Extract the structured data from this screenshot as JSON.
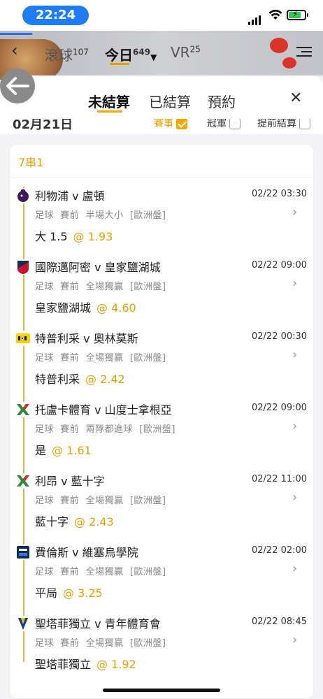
{
  "status": {
    "time": "22:24"
  },
  "app_header": {
    "tabs": [
      {
        "label": "滾球",
        "count": "107"
      },
      {
        "label": "今日",
        "count": "649"
      },
      {
        "label": "VR",
        "count": "25"
      }
    ]
  },
  "sheet": {
    "tabs": [
      "未結算",
      "已結算",
      "預約"
    ],
    "date": "02月21日",
    "filters": [
      {
        "label": "賽事",
        "checked": true
      },
      {
        "label": "冠軍",
        "checked": false
      },
      {
        "label": "提前結算",
        "checked": false
      }
    ],
    "parlay_title": "7串1",
    "legs": [
      {
        "match": "利物浦 v 盧頓",
        "datetime": "02/22 03:30",
        "sport": "足球",
        "stage": "賽前",
        "market": "半場大小",
        "line": "[歐洲盤]",
        "pick": "大 1.5",
        "odds": "@ 1.93",
        "logo_icon": "premier-league-icon"
      },
      {
        "match": "國際邁阿密 v 皇家鹽湖城",
        "datetime": "02/22 09:00",
        "sport": "足球",
        "stage": "賽前",
        "market": "全場獨贏",
        "line": "[歐洲盤]",
        "pick": "皇家鹽湖城",
        "odds": "@ 4.60",
        "logo_icon": "mls-icon"
      },
      {
        "match": "特普利采 v 奧林莫斯",
        "datetime": "02/22 00:30",
        "sport": "足球",
        "stage": "賽前",
        "market": "全場獨贏",
        "line": "[歐洲盤]",
        "pick": "特普利采",
        "odds": "@ 2.42",
        "logo_icon": "fortuna-liga-icon"
      },
      {
        "match": "托盧卡體育 v 山度士拿根亞",
        "datetime": "02/22 09:00",
        "sport": "足球",
        "stage": "賽前",
        "market": "兩隊都進球",
        "line": "[歐洲盤]",
        "pick": "是",
        "odds": "@ 1.61",
        "logo_icon": "liga-mx-icon"
      },
      {
        "match": "利昂 v 藍十字",
        "datetime": "02/22 11:00",
        "sport": "足球",
        "stage": "賽前",
        "market": "全場獨贏",
        "line": "[歐洲盤]",
        "pick": "藍十字",
        "odds": "@ 2.43",
        "logo_icon": "liga-mx-icon"
      },
      {
        "match": "費倫斯 v 維塞烏學院",
        "datetime": "02/22 02:00",
        "sport": "足球",
        "stage": "賽前",
        "market": "全場獨贏",
        "line": "[歐洲盤]",
        "pick": "平局",
        "odds": "@ 3.25",
        "logo_icon": "liga-portugal-icon"
      },
      {
        "match": "聖塔菲獨立 v 青年體育會",
        "datetime": "02/22 08:45",
        "sport": "足球",
        "stage": "賽前",
        "market": "全場獨贏",
        "line": "[歐洲盤]",
        "pick": "聖塔菲獨立",
        "odds": "@ 1.92",
        "logo_icon": "colombia-liga-icon"
      }
    ]
  },
  "colors": {
    "accent": "#f2a900",
    "status_pill": "#1f7cf5"
  }
}
